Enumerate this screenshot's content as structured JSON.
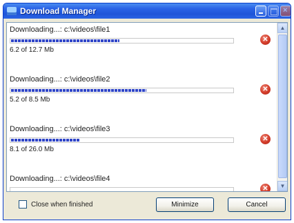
{
  "window": {
    "title": "Download Manager"
  },
  "downloads": [
    {
      "label": "Downloading...: c:\\videos\\file1",
      "size": "6.2 of 12.7 Mb",
      "progress": 0.488
    },
    {
      "label": "Downloading...: c:\\videos\\file2",
      "size": "5.2 of 8.5 Mb",
      "progress": 0.612
    },
    {
      "label": "Downloading...: c:\\videos\\file3",
      "size": "8.1 of 26.0 Mb",
      "progress": 0.312
    },
    {
      "label": "Downloading...: c:\\videos\\file4",
      "size": "",
      "progress": 0
    }
  ],
  "footer": {
    "checkbox_label": "Close when finished",
    "checkbox_checked": false,
    "minimize_label": "Minimize",
    "cancel_label": "Cancel"
  },
  "icons": {
    "cancel_download": "cancel-circle-icon",
    "title": "download-manager-icon"
  },
  "colors": {
    "titlebar": "#2a62e6",
    "progress": "#2f45c8",
    "cancel": "#d23a28"
  }
}
